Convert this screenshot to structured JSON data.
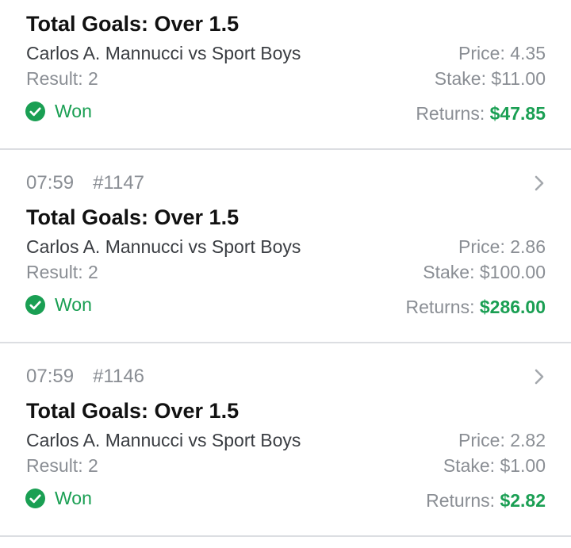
{
  "colors": {
    "won_green": "#1a9f53",
    "muted_text": "#8a8e94",
    "divider": "#dcdee2"
  },
  "bets": [
    {
      "time": "",
      "bet_id": "",
      "market": "Total Goals: Over 1.5",
      "event": "Carlos A. Mannucci vs Sport Boys",
      "result": "Result: 2",
      "status": "Won",
      "status_icon": "check-circle-icon",
      "price": "Price: 4.35",
      "stake": "Stake: $11.00",
      "returns_label": "Returns:",
      "returns_amount": "$47.85"
    },
    {
      "time": "07:59",
      "bet_id": "#1147",
      "market": "Total Goals: Over 1.5",
      "event": "Carlos A. Mannucci vs Sport Boys",
      "result": "Result: 2",
      "status": "Won",
      "status_icon": "check-circle-icon",
      "price": "Price: 2.86",
      "stake": "Stake: $100.00",
      "returns_label": "Returns:",
      "returns_amount": "$286.00"
    },
    {
      "time": "07:59",
      "bet_id": "#1146",
      "market": "Total Goals: Over 1.5",
      "event": "Carlos A. Mannucci vs Sport Boys",
      "result": "Result: 2",
      "status": "Won",
      "status_icon": "check-circle-icon",
      "price": "Price: 2.82",
      "stake": "Stake: $1.00",
      "returns_label": "Returns:",
      "returns_amount": "$2.82"
    }
  ]
}
